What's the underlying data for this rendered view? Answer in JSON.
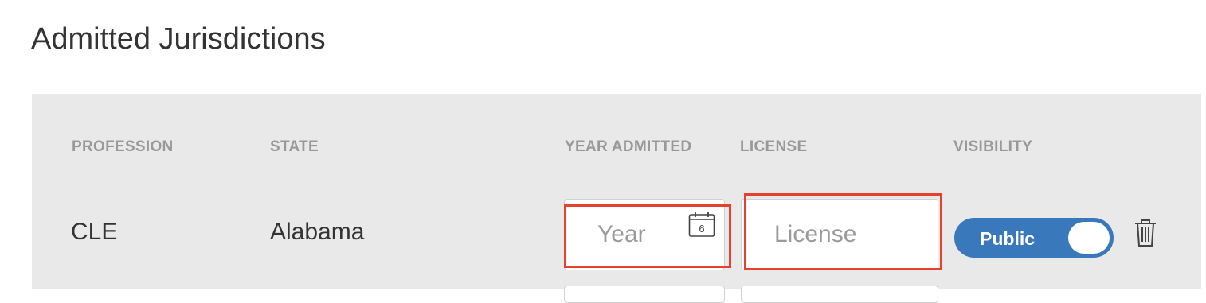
{
  "section": {
    "title": "Admitted Jurisdictions"
  },
  "table": {
    "headers": {
      "profession": "PROFESSION",
      "state": "STATE",
      "year_admitted": "YEAR ADMITTED",
      "license": "LICENSE",
      "visibility": "VISIBILITY"
    },
    "row": {
      "profession": "CLE",
      "state": "Alabama",
      "year_placeholder": "Year",
      "calendar_day": "6",
      "license_placeholder": "License",
      "visibility_label": "Public",
      "visibility_on": true
    }
  },
  "icons": {
    "calendar": "calendar-icon",
    "trash": "trash-icon"
  },
  "colors": {
    "panel_bg": "#e9e9e9",
    "highlight": "#e4422c",
    "toggle": "#3a78bc",
    "header_text": "#999999",
    "body_text": "#333333"
  }
}
